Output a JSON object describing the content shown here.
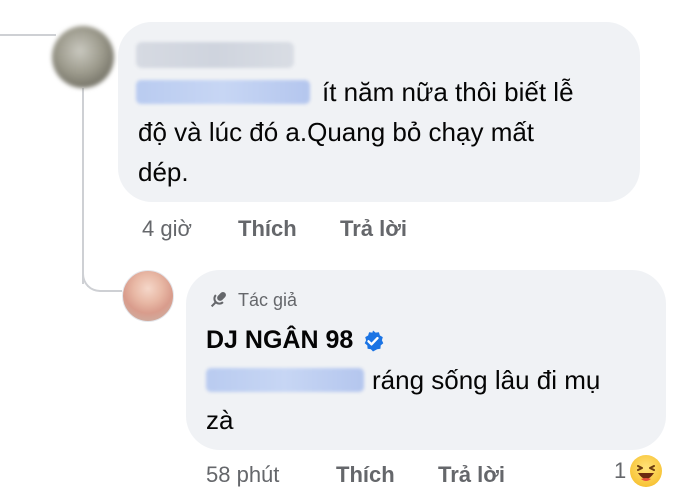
{
  "comment": {
    "text_lines": [
      "ít năm nữa thôi biết lễ",
      "độ và lúc đó a.Quang bỏ chạy mất",
      "dép."
    ],
    "time": "4 giờ",
    "like_label": "Thích",
    "reply_label": "Trả lời"
  },
  "reply": {
    "author_badge": "Tác giả",
    "name": "DJ NGÂN 98",
    "text_lines": [
      "ráng sống lâu đi mụ",
      "zà"
    ],
    "time": "58 phút",
    "like_label": "Thích",
    "reply_label": "Trả lời",
    "reaction_count": "1",
    "reaction_icon": "laughing-emoji-icon"
  },
  "colors": {
    "bubble": "#f0f2f5",
    "meta_text": "#65676b",
    "verified": "#1b74e4",
    "thread_line": "#ced0d4"
  }
}
